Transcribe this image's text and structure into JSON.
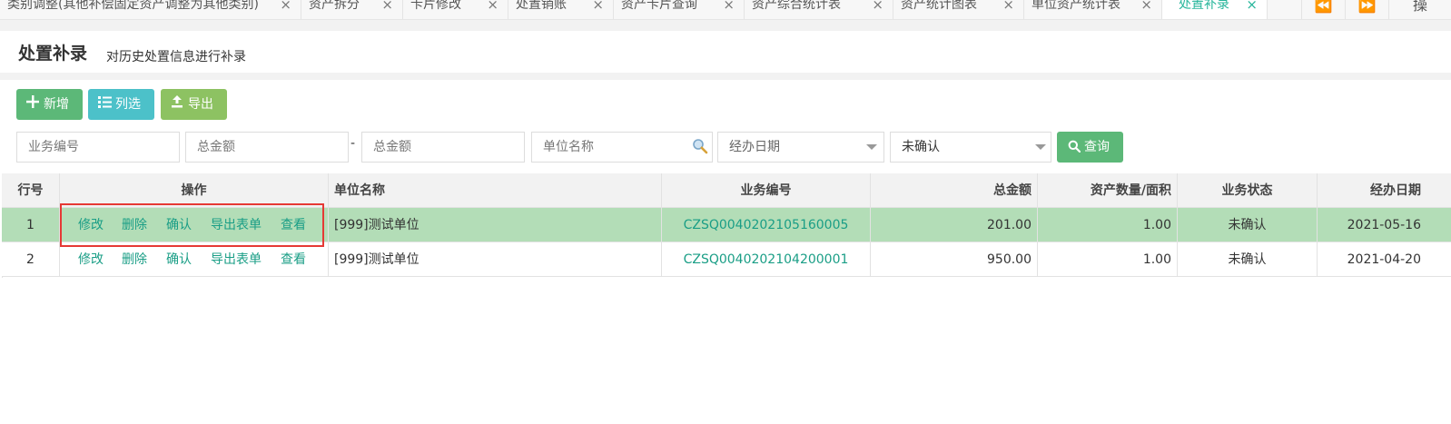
{
  "tabs": [
    {
      "label": "类别调整(其他补偿固定资产调整为其他类别)",
      "active": false
    },
    {
      "label": "资产拆分",
      "active": false
    },
    {
      "label": "卡片修改",
      "active": false
    },
    {
      "label": "处置销账",
      "active": false
    },
    {
      "label": "资产卡片查询",
      "active": false
    },
    {
      "label": "资产综合统计表",
      "active": false
    },
    {
      "label": "资产统计图表",
      "active": false
    },
    {
      "label": "单位资产统计表",
      "active": false
    },
    {
      "label": "处置补录",
      "active": true
    }
  ],
  "tab_close_symbol": "×",
  "nav": {
    "prev": "⏪",
    "next": "⏩",
    "more": "操"
  },
  "page": {
    "title": "处置补录",
    "subtitle": "对历史处置信息进行补录"
  },
  "toolbar": {
    "add_label": "新增",
    "add_icon": "plus-icon",
    "columns_label": "列选",
    "columns_icon": "list-icon",
    "export_label": "导出",
    "export_icon": "upload-icon"
  },
  "filters": {
    "business_no_placeholder": "业务编号",
    "amount_from_placeholder": "总金额",
    "range_separator": "-",
    "amount_to_placeholder": "总金额",
    "unit_name_placeholder": "单位名称",
    "handle_date_placeholder": "经办日期",
    "status_value": "未确认",
    "query_label": "查询"
  },
  "table": {
    "columns": [
      "行号",
      "操作",
      "单位名称",
      "业务编号",
      "总金额",
      "资产数量/面积",
      "业务状态",
      "经办日期"
    ],
    "actions": [
      "修改",
      "删除",
      "确认",
      "导出表单",
      "查看"
    ],
    "rows": [
      {
        "no": "1",
        "unit": "[999]测试单位",
        "business_no": "CZSQ0040202105160005",
        "amount": "201.00",
        "quantity": "1.00",
        "status": "未确认",
        "date": "2021-05-16",
        "selected": true
      },
      {
        "no": "2",
        "unit": "[999]测试单位",
        "business_no": "CZSQ0040202104200001",
        "amount": "950.00",
        "quantity": "1.00",
        "status": "未确认",
        "date": "2021-04-20",
        "selected": false
      }
    ]
  },
  "colors": {
    "accent": "#26b59a",
    "green_button": "#5cb878",
    "teal_button": "#4cc1c9",
    "lime_button": "#8dc262",
    "selected_row": "#b3ddb7",
    "highlight_box": "#e53935"
  }
}
